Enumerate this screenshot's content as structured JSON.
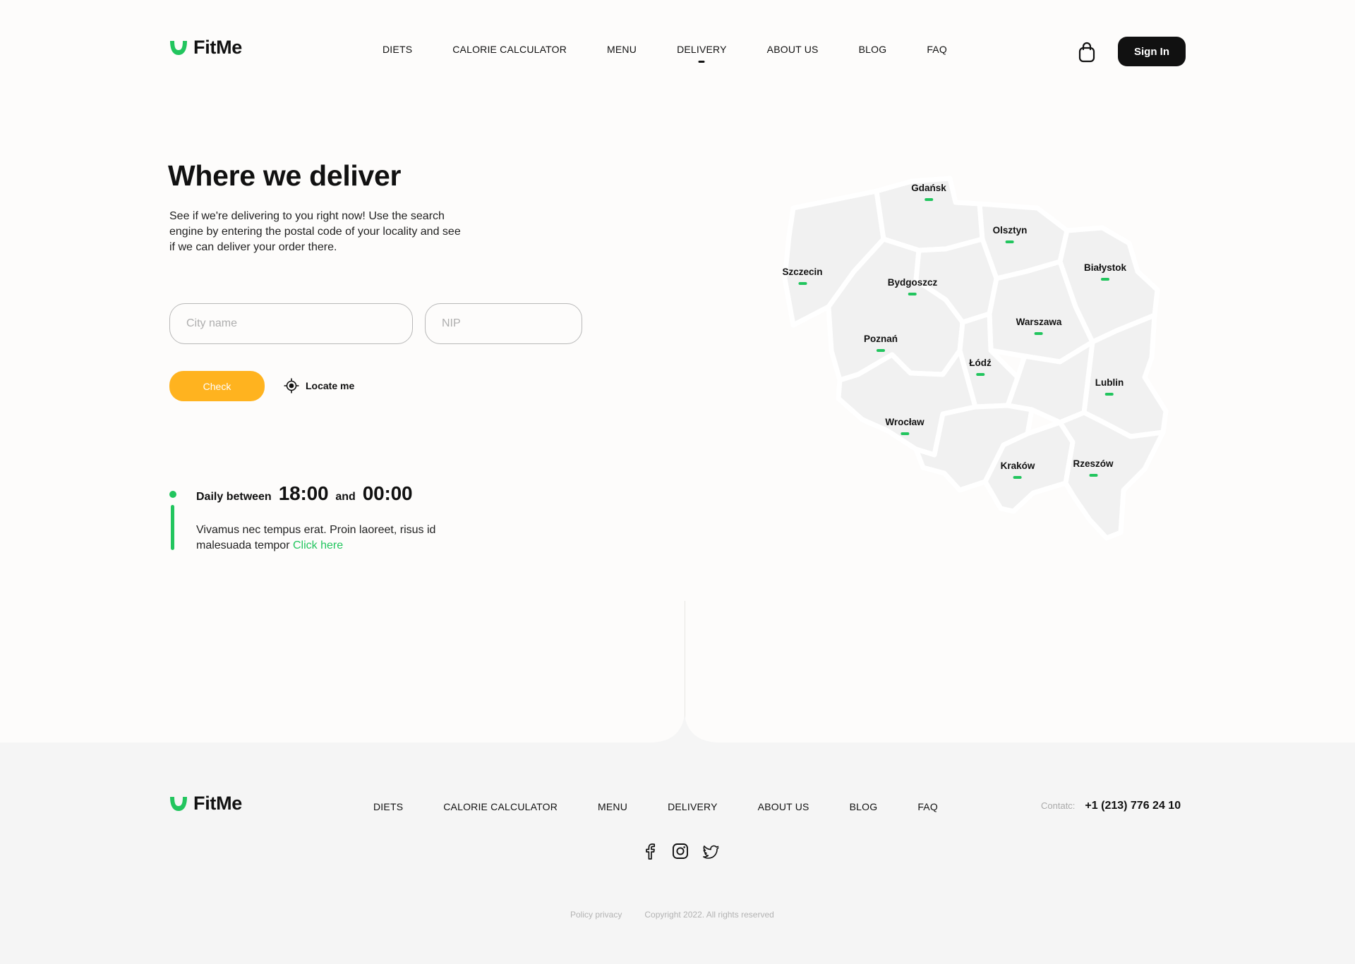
{
  "brand": {
    "name": "FitMe",
    "accent": "#22C55E"
  },
  "header": {
    "nav": [
      "DIETS",
      "CALORIE CALCULATOR",
      "MENU",
      "DELIVERY",
      "ABOUT US",
      "BLOG",
      "FAQ"
    ],
    "active_nav": "DELIVERY",
    "cart_icon": "shopping-bag-icon",
    "signin_label": "Sign In"
  },
  "hero": {
    "title": "Where we deliver",
    "description": "See if we're delivering to you right now! Use the search engine by entering the postal code of your locality and see if we can deliver your order there.",
    "city_placeholder": "City name",
    "city_value": "",
    "nip_placeholder": "NIP",
    "nip_value": "",
    "check_label": "Check",
    "check_color": "#FFB31F",
    "locate_label": "Locate me",
    "locate_icon": "crosshair-icon"
  },
  "hours": {
    "label_daily": "Daily between",
    "from": "18:00",
    "label_and": "and",
    "to": "00:00",
    "text": "Vivamus nec tempus erat. Proin laoreet, risus id malesuada tempor",
    "link_text": "Click here"
  },
  "map": {
    "cities": [
      "Gdańsk",
      "Olsztyn",
      "Szczecin",
      "Bydgoszcz",
      "Białystok",
      "Warszawa",
      "Poznań",
      "Łódź",
      "Lublin",
      "Wrocław",
      "Kraków",
      "Rzeszów"
    ]
  },
  "footer": {
    "nav": [
      "DIETS",
      "CALORIE CALCULATOR",
      "MENU",
      "DELIVERY",
      "ABOUT US",
      "BLOG",
      "FAQ"
    ],
    "contact_label": "Contatc:",
    "phone": "+1 (213) 776 24 10",
    "social_icons": [
      "facebook-icon",
      "instagram-icon",
      "twitter-icon"
    ],
    "policy": "Policy privacy",
    "copyright": "Copyright 2022. All rights reserved"
  }
}
